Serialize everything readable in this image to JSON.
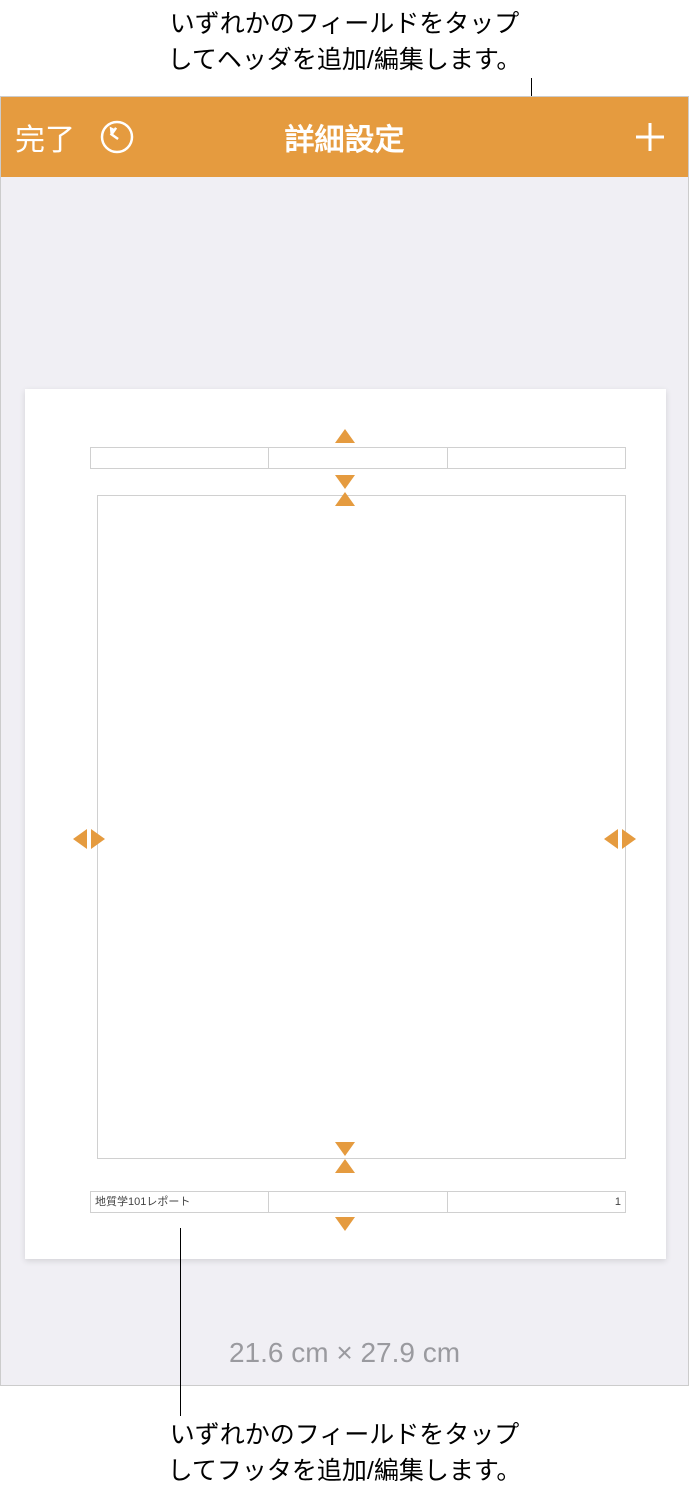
{
  "callouts": {
    "top_line1": "いずれかのフィールドをタップ",
    "top_line2": "してヘッダを追加/編集します。",
    "bottom_line1": "いずれかのフィールドをタップ",
    "bottom_line2": "してフッタを追加/編集します。"
  },
  "toolbar": {
    "done_label": "完了",
    "title": "詳細設定"
  },
  "page": {
    "header": {
      "left": "",
      "center": "",
      "right": ""
    },
    "footer": {
      "left": "地質学101レポート",
      "center": "",
      "right": "1"
    },
    "size_label": "21.6 cm × 27.9 cm"
  }
}
